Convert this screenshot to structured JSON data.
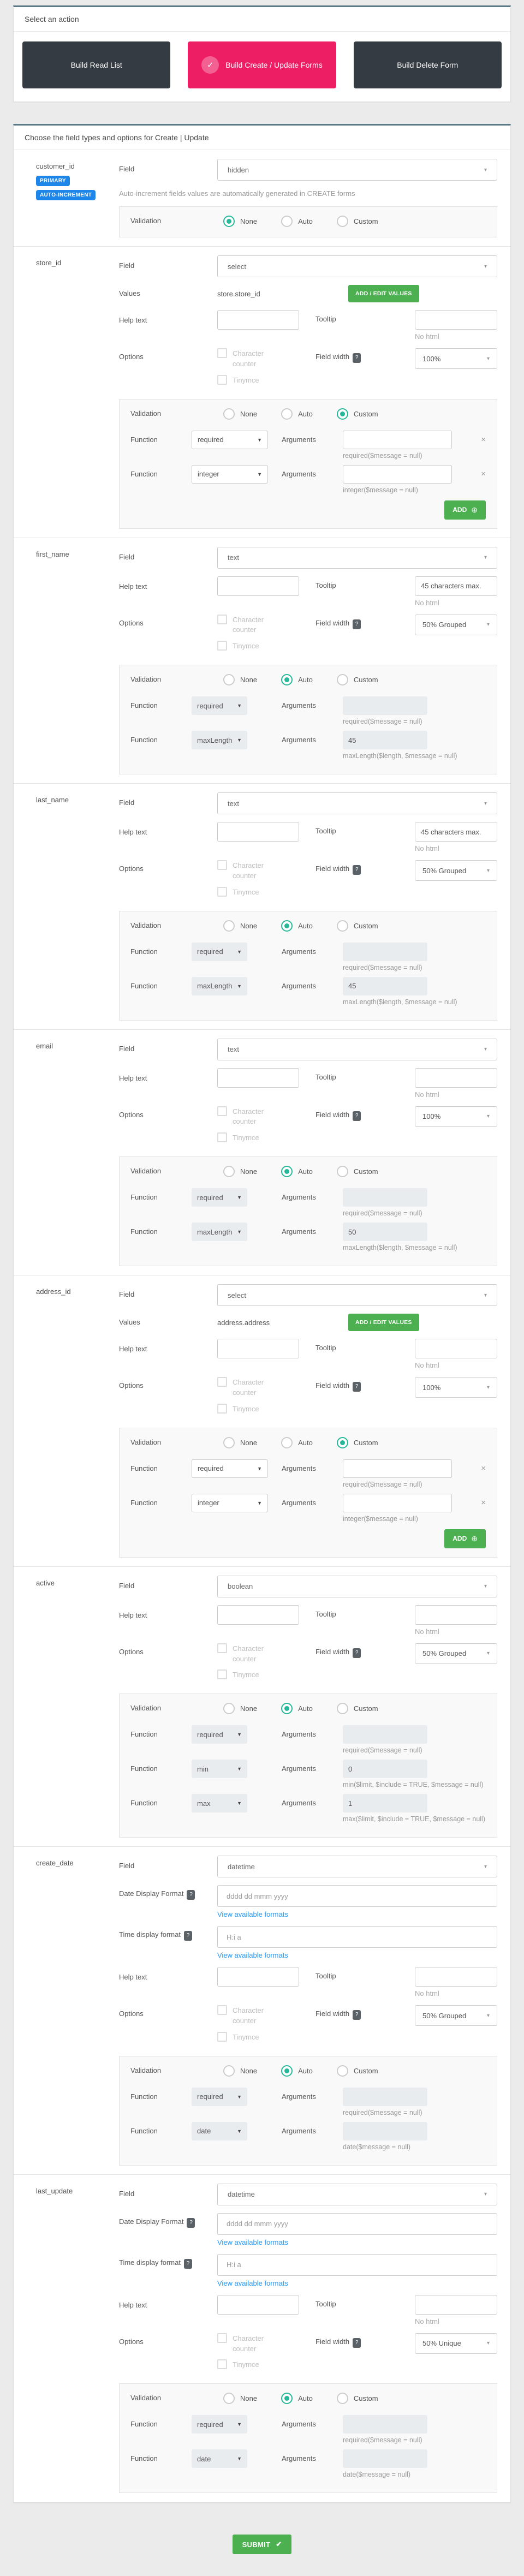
{
  "colors": {
    "page_bg": "#ebebeb",
    "panel_top_border": "#5b7886",
    "dark_button": "#353b43",
    "active_button_pink": "#ee1e64",
    "badge_blue": "#1d86e8",
    "green": "#4caf50",
    "radio_selected": "#26b999",
    "link_blue": "#2196f3"
  },
  "icons": {
    "check": "✓",
    "submit_check": "✔",
    "plus_circle": "⊕",
    "question": "?",
    "dropdown_arrow": "▾",
    "remove": "×"
  },
  "action_panel": {
    "title": "Select an action",
    "buttons": [
      {
        "label": "Build Read List",
        "active": false
      },
      {
        "label": "Build Create / Update Forms",
        "active": true
      },
      {
        "label": "Build Delete Form",
        "active": false
      }
    ]
  },
  "fields_panel": {
    "title": "Choose the field types and options for Create | Update",
    "labels": {
      "field": "Field",
      "values": "Values",
      "add_edit_values": "ADD / EDIT VALUES",
      "help_text": "Help text",
      "tooltip": "Tooltip",
      "no_html": "No html",
      "options": "Options",
      "character_counter": "Character counter",
      "tinymce": "Tinymce",
      "field_width": "Field width",
      "date_display_format": "Date Display Format",
      "time_display_format": "Time display format",
      "view_formats": "View available formats",
      "validation": "Validation",
      "radio_none": "None",
      "radio_auto": "Auto",
      "radio_custom": "Custom",
      "function": "Function",
      "arguments": "Arguments",
      "add": "ADD"
    },
    "fields": [
      {
        "name": "customer_id",
        "badges": [
          "PRIMARY",
          "AUTO-INCREMENT"
        ],
        "field_type": "hidden",
        "note": "Auto-increment fields values are automatically generated in CREATE forms",
        "validation": "None",
        "functions": []
      },
      {
        "name": "store_id",
        "field_type": "select",
        "values": "store.store_id",
        "help_text": "",
        "tooltip": "",
        "field_width": "100%",
        "validation": "Custom",
        "functions": [
          {
            "name": "required",
            "args": "",
            "hint": "required($message = null)"
          },
          {
            "name": "integer",
            "args": "",
            "hint": "integer($message = null)"
          }
        ]
      },
      {
        "name": "first_name",
        "field_type": "text",
        "help_text": "",
        "tooltip": "45 characters max.",
        "field_width": "50% Grouped",
        "validation": "Auto",
        "functions": [
          {
            "name": "required",
            "args": "",
            "hint": "required($message = null)"
          },
          {
            "name": "maxLength",
            "args": "45",
            "hint": "maxLength($length, $message = null)"
          }
        ]
      },
      {
        "name": "last_name",
        "field_type": "text",
        "help_text": "",
        "tooltip": "45 characters max.",
        "field_width": "50% Grouped",
        "validation": "Auto",
        "functions": [
          {
            "name": "required",
            "args": "",
            "hint": "required($message = null)"
          },
          {
            "name": "maxLength",
            "args": "45",
            "hint": "maxLength($length, $message = null)"
          }
        ]
      },
      {
        "name": "email",
        "field_type": "text",
        "help_text": "",
        "tooltip": "",
        "field_width": "100%",
        "validation": "Auto",
        "functions": [
          {
            "name": "required",
            "args": "",
            "hint": "required($message = null)"
          },
          {
            "name": "maxLength",
            "args": "50",
            "hint": "maxLength($length, $message = null)"
          }
        ]
      },
      {
        "name": "address_id",
        "field_type": "select",
        "values": "address.address",
        "help_text": "",
        "tooltip": "",
        "field_width": "100%",
        "validation": "Custom",
        "functions": [
          {
            "name": "required",
            "args": "",
            "hint": "required($message = null)"
          },
          {
            "name": "integer",
            "args": "",
            "hint": "integer($message = null)"
          }
        ]
      },
      {
        "name": "active",
        "field_type": "boolean",
        "help_text": "",
        "tooltip": "",
        "field_width": "50% Grouped",
        "validation": "Auto",
        "functions": [
          {
            "name": "required",
            "args": "",
            "hint": "required($message = null)"
          },
          {
            "name": "min",
            "args": "0",
            "hint": "min($limit, $include = TRUE, $message = null)"
          },
          {
            "name": "max",
            "args": "1",
            "hint": "max($limit, $include = TRUE, $message = null)"
          }
        ]
      },
      {
        "name": "create_date",
        "field_type": "datetime",
        "date_format": "dddd dd mmm yyyy",
        "time_format": "H:i a",
        "help_text": "",
        "tooltip": "",
        "field_width": "50% Grouped",
        "validation": "Auto",
        "functions": [
          {
            "name": "required",
            "args": "",
            "hint": "required($message = null)"
          },
          {
            "name": "date",
            "args": "",
            "hint": "date($message = null)"
          }
        ]
      },
      {
        "name": "last_update",
        "field_type": "datetime",
        "date_format": "dddd dd mmm yyyy",
        "time_format": "H:i a",
        "help_text": "",
        "tooltip": "",
        "field_width": "50% Unique",
        "validation": "Auto",
        "functions": [
          {
            "name": "required",
            "args": "",
            "hint": "required($message = null)"
          },
          {
            "name": "date",
            "args": "",
            "hint": "date($message = null)"
          }
        ]
      }
    ]
  },
  "submit": {
    "label": "SUBMIT"
  }
}
